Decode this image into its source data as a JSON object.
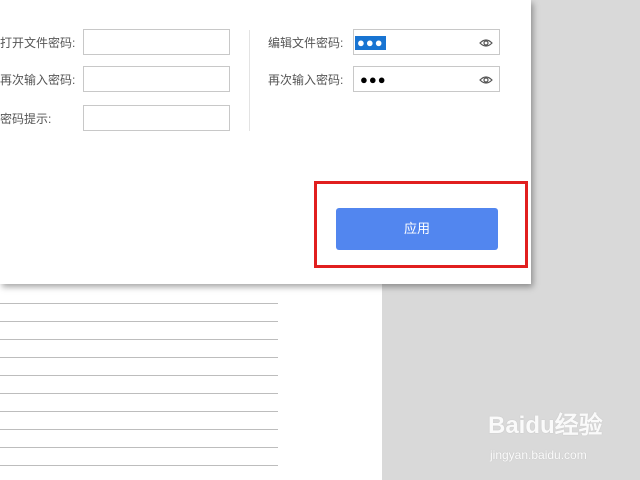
{
  "dialog": {
    "left_form": {
      "open_password_label": "打开文件密码:",
      "open_password_value": "",
      "repeat_password_label": "再次输入密码:",
      "repeat_password_value": "",
      "hint_label": "密码提示:",
      "hint_value": ""
    },
    "right_form": {
      "edit_password_label": "编辑文件密码:",
      "edit_password_masked": "●●●",
      "repeat_password_label": "再次输入密码:",
      "repeat_password_masked": "●●●"
    },
    "apply_button_label": "应用"
  },
  "colors": {
    "apply_button": "#5286ef",
    "highlight_border": "#e11f1f",
    "selected_text": "#1874d2"
  },
  "icons": [
    "eye-icon"
  ],
  "watermark": {
    "brand": "Baidu经验",
    "url": "jingyan.baidu.com"
  }
}
